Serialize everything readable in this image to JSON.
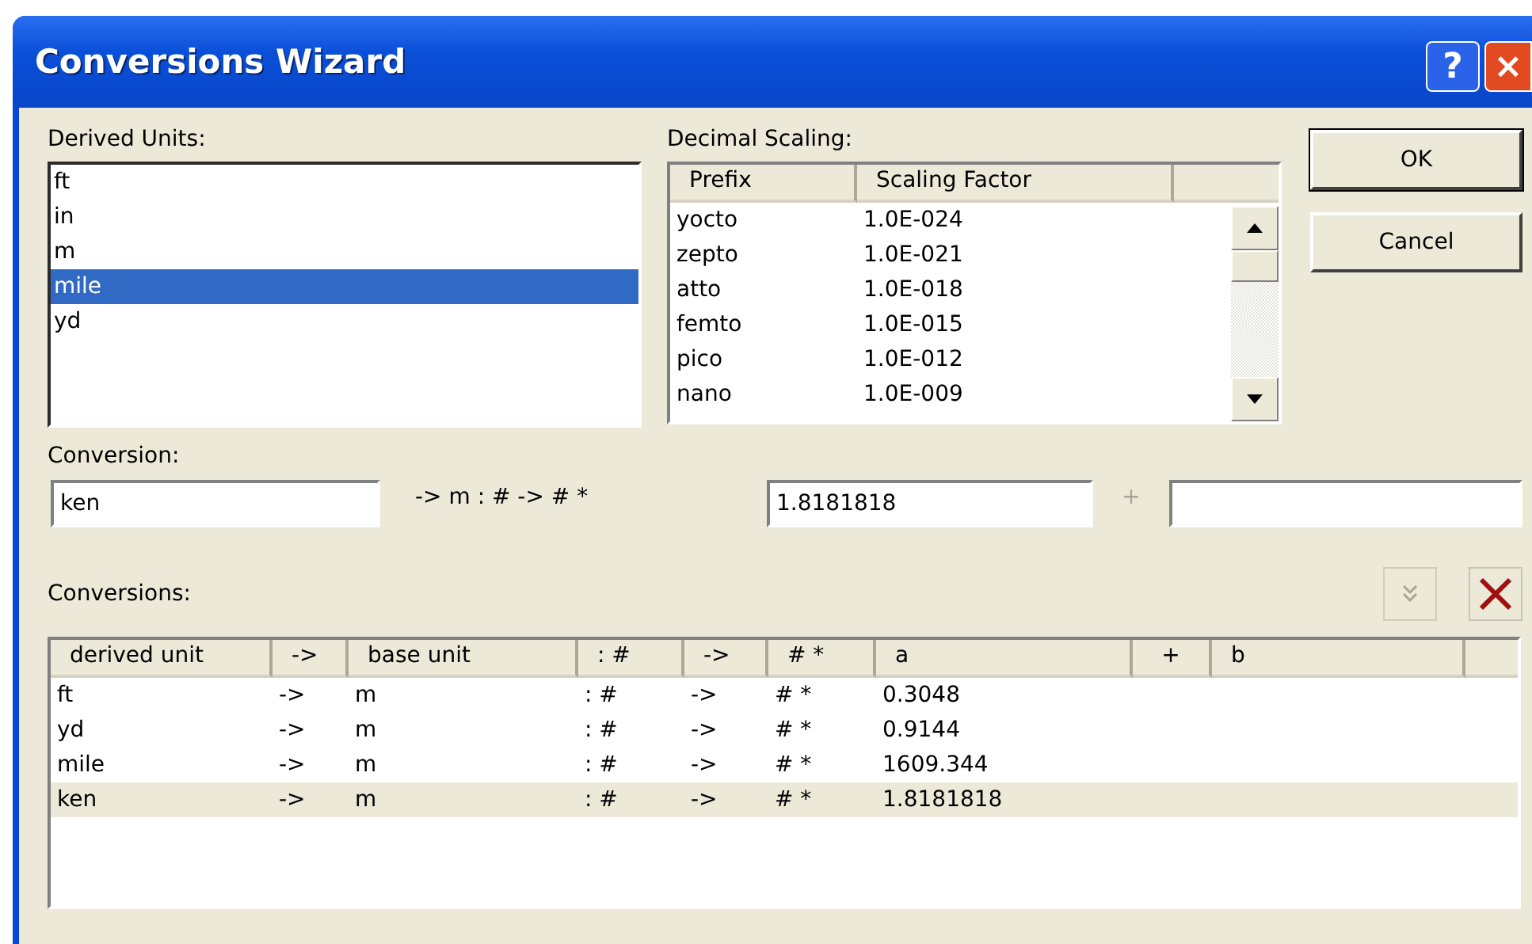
{
  "window": {
    "title": "Conversions Wizard",
    "help": "?",
    "close": "×"
  },
  "derived_units": {
    "label": "Derived Units:",
    "items": [
      {
        "text": "ft",
        "selected": false
      },
      {
        "text": "in",
        "selected": false
      },
      {
        "text": "m",
        "selected": false
      },
      {
        "text": "mile",
        "selected": true
      },
      {
        "text": "yd",
        "selected": false
      }
    ]
  },
  "decimal_scaling": {
    "label": "Decimal Scaling:",
    "columns": [
      "Prefix",
      "Scaling Factor"
    ],
    "rows": [
      [
        "yocto",
        "1.0E-024"
      ],
      [
        "zepto",
        "1.0E-021"
      ],
      [
        "atto",
        "1.0E-018"
      ],
      [
        "femto",
        "1.0E-015"
      ],
      [
        "pico",
        "1.0E-012"
      ],
      [
        "nano",
        "1.0E-009"
      ]
    ]
  },
  "buttons": [
    {
      "label": "OK",
      "default": true
    },
    {
      "label": "Cancel",
      "default": false
    }
  ],
  "conversion": {
    "label": "Conversion:",
    "unit": "ken",
    "formula": "-> m :  # -> # *",
    "a": "1.8181818",
    "plus": "+"
  },
  "conversions": {
    "label": "Conversions:",
    "add_disabled": true,
    "columns": [
      "derived unit",
      "->",
      "base unit",
      ": #",
      "->",
      "# *",
      "a",
      "+",
      "b"
    ],
    "rows": [
      {
        "cells": [
          "ft",
          "->",
          "m",
          ": #",
          "->",
          "# *",
          "0.3048"
        ],
        "selected": false
      },
      {
        "cells": [
          "yd",
          "->",
          "m",
          ": #",
          "->",
          "# *",
          "0.9144"
        ],
        "selected": false
      },
      {
        "cells": [
          "mile",
          "->",
          "m",
          ": #",
          "->",
          "# *",
          "1609.344"
        ],
        "selected": false
      },
      {
        "cells": [
          "ken",
          "->",
          "m",
          ": #",
          "->",
          "# *",
          "1.8181818"
        ],
        "selected": true
      }
    ]
  }
}
